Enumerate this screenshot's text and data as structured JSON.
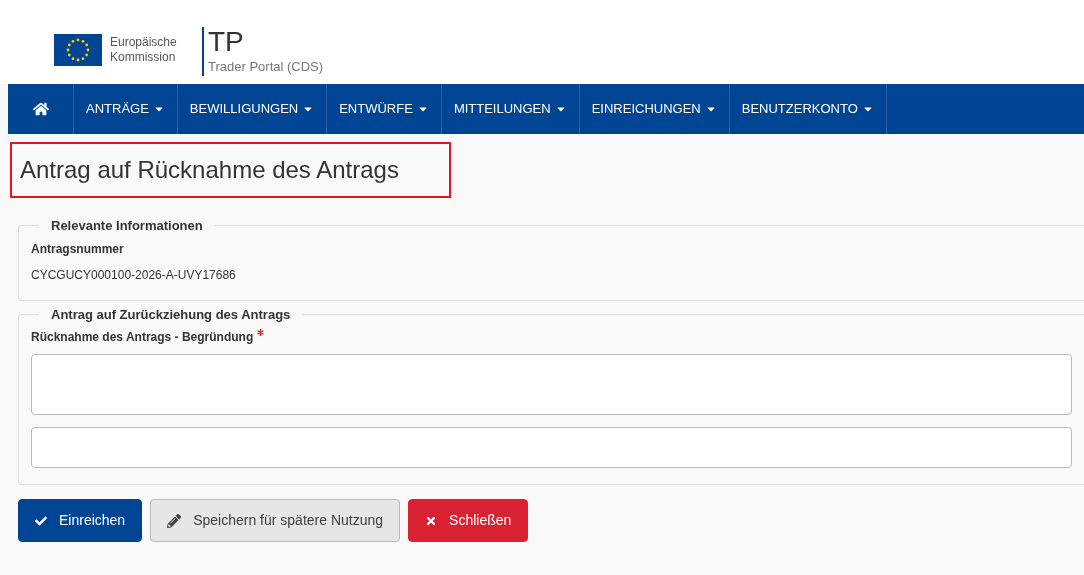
{
  "header": {
    "logo_text": "Europäische Kommission",
    "app_title": "TP",
    "app_subtitle": "Trader Portal (CDS)"
  },
  "nav": {
    "items": [
      {
        "label": "ANTRÄGE"
      },
      {
        "label": "BEWILLIGUNGEN"
      },
      {
        "label": "ENTWÜRFE"
      },
      {
        "label": "MITTEILUNGEN"
      },
      {
        "label": "EINREICHUNGEN"
      },
      {
        "label": "BENUTZERKONTO"
      }
    ]
  },
  "page_title": "Antrag auf Rücknahme des Antrags",
  "sections": [
    {
      "legend": "Relevante Informationen",
      "fields": [
        {
          "kind": "readonly",
          "label": "Antragsnummer",
          "value": "CYCGUCY000100-2026-A-UVY17686"
        }
      ]
    },
    {
      "legend": "Antrag auf Zurückziehung des Antrags",
      "fields": [
        {
          "kind": "textarea",
          "label": "Rücknahme des Antrags - Begründung",
          "required": true
        }
      ]
    }
  ],
  "buttons": [
    {
      "kind": "primary",
      "label": "Einreichen"
    },
    {
      "kind": "secondary",
      "label": "Speichern für spätere Nutzung"
    },
    {
      "kind": "danger",
      "label": "Schließen"
    }
  ]
}
